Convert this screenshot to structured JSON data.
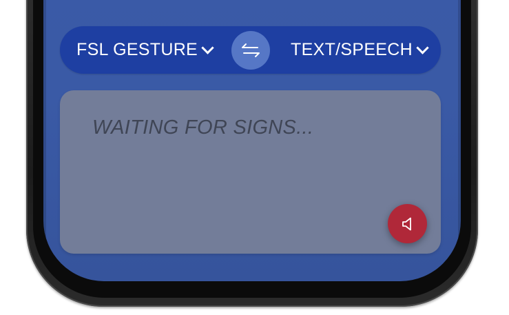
{
  "translator": {
    "source_language": "FSL GESTURE",
    "target_language": "TEXT/SPEECH",
    "swap_icon": "swap-arrows-icon",
    "output_placeholder": "WAITING FOR SIGNS...",
    "speak_icon": "speaker-icon"
  },
  "colors": {
    "screen_bg": "#3b5ba8",
    "lang_bar_bg": "#1e3fa2",
    "swap_button_bg": "#5677c6",
    "output_panel_bg": "#737d99",
    "placeholder_text": "#3f4555",
    "speak_button_bg": "#b02839"
  }
}
